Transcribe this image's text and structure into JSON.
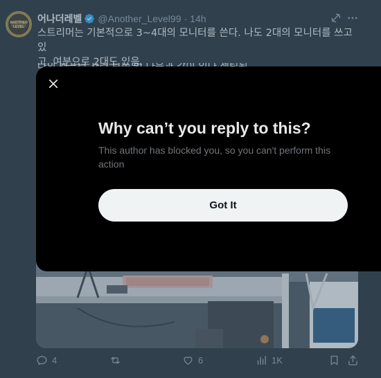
{
  "tweet": {
    "author_name": "어나더레벨",
    "handle": "@Another_Level99",
    "separator": "·",
    "time": "14h",
    "text_line1": "스트리머는 기본적으로 3~4대의 모니터를 쓴다. 나도 2대의 모니터를 쓰고 있",
    "text_line2": "고. 여분으로 2대도 있음.",
    "text_line3_partial": "나의 컴퓨터 자리 보는 법 다음과 같이 있다 셋팅됨",
    "avatar_text": "ANOTHER LEVEL",
    "stats": {
      "replies": "4",
      "retweets": "",
      "likes": "6",
      "views": "1K"
    }
  },
  "modal": {
    "title": "Why can’t you reply to this?",
    "body": "This author has blocked you, so you can't perform this action",
    "button_label": "Got It"
  },
  "colors": {
    "background": "#15202b",
    "modal": "#000000",
    "verified": "#1d9bf0",
    "muted": "#8b98a5",
    "button": "#eff3f4"
  }
}
